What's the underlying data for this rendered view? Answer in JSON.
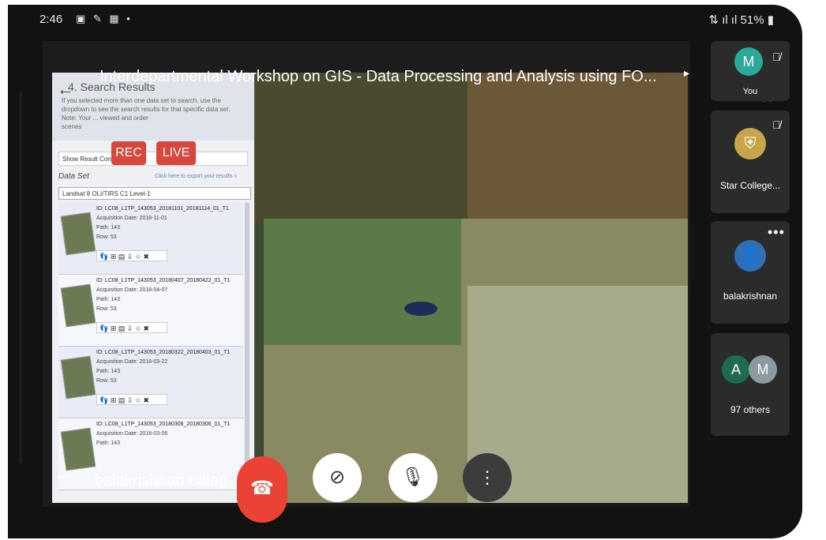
{
  "status_bar": {
    "time": "2:46",
    "notif_icons": "▣ ✎ ▦ •",
    "signal_battery": "51%"
  },
  "meeting": {
    "title": "Interdepartmental Workshop on GIS - Data Processing and Analysis using FO...",
    "rec_badge": "REC",
    "live_badge": "LIVE",
    "presenter_name": "balakrishnan balag"
  },
  "shared_screen": {
    "panel_title": "4. Search Results",
    "note_line1": "If you selected more than one data set to search, use the",
    "note_line2": "dropdown to see the search results for that specific data set.",
    "note_line3": "Note: Your ... viewed and order",
    "note_line4": "scenes",
    "show_result_controls": "Show Result Controls",
    "data_set_label": "Data Set",
    "export_link": "Click here to export your results »",
    "selected_dataset": "Landsat 8 OLI/TIRS C1 Level-1",
    "results": [
      {
        "id": "ID: LC08_L1TP_143053_20181101_20181114_01_T1",
        "date": "Acquisition Date: 2018-11-01",
        "path": "Path: 143",
        "row": "Row: 53"
      },
      {
        "id": "ID: LC08_L1TP_143053_20180407_20180422_01_T1",
        "date": "Acquisition Date: 2018-04-07",
        "path": "Path: 143",
        "row": "Row: 53"
      },
      {
        "id": "ID: LC08_L1TP_143053_20180322_20180403_01_T1",
        "date": "Acquisition Date: 2018-03-22",
        "path": "Path: 143",
        "row": "Row: 53"
      },
      {
        "id": "ID: LC08_L1TP_143053_20180306_20180306_01_T1",
        "date": "Acquisition Date: 2018-03-06",
        "path": "Path: 143",
        "row": ""
      }
    ],
    "result_action_icons": "👣 ⊞ ▤ ⇩ ☆ ✖"
  },
  "participants": [
    {
      "initial": "M",
      "name": "You",
      "avatar_color": "#2aa89a",
      "muted": true
    },
    {
      "initial": "",
      "name": "Star College...",
      "avatar_color": "#c8a54a",
      "muted": true
    },
    {
      "initial": "",
      "name": "balakrishnan",
      "avatar_color": "#2f6fb5",
      "muted": false
    },
    {
      "initial": "A",
      "initial2": "M",
      "name": "97 others",
      "avatar_color": "#1f6b4f",
      "avatar_color2": "#8a9aa0"
    }
  ],
  "controls": {
    "hangup_icon": "phone-hangup-icon",
    "camera_icon": "camera-off-icon",
    "mic_icon": "mic-off-icon",
    "more_icon": "more-vert-icon"
  },
  "colors": {
    "record_red": "#d9463b",
    "hangup_red": "#ea4335"
  }
}
